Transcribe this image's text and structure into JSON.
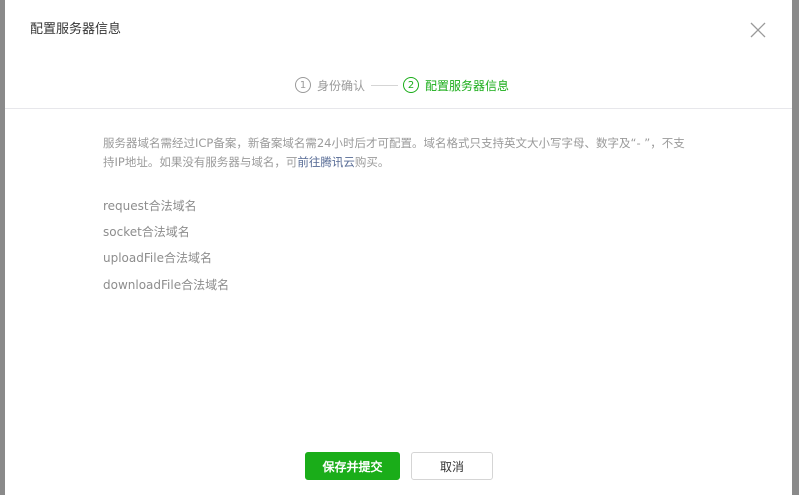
{
  "dialog": {
    "title": "配置服务器信息",
    "close_icon": "close-icon"
  },
  "steps": [
    {
      "number": "1",
      "label": "身份确认",
      "state": "done"
    },
    {
      "number": "2",
      "label": "配置服务器信息",
      "state": "active"
    }
  ],
  "notice": {
    "text_before": "服务器域名需经过ICP备案，新备案域名需24小时后才可配置。域名格式只支持英文大小写字母、数字及“- ”，不支持IP地址。如果没有服务器与域名，可",
    "link_text": "前往腾讯云",
    "text_after": "购买。"
  },
  "domains": [
    {
      "label": "request合法域名"
    },
    {
      "label": "socket合法域名"
    },
    {
      "label": "uploadFile合法域名"
    },
    {
      "label": "downloadFile合法域名"
    }
  ],
  "buttons": {
    "save_label": "保存并提交",
    "cancel_label": "取消"
  },
  "colors": {
    "accent": "#1aad19",
    "link": "#576b95",
    "muted_text": "#9a9a9a"
  }
}
